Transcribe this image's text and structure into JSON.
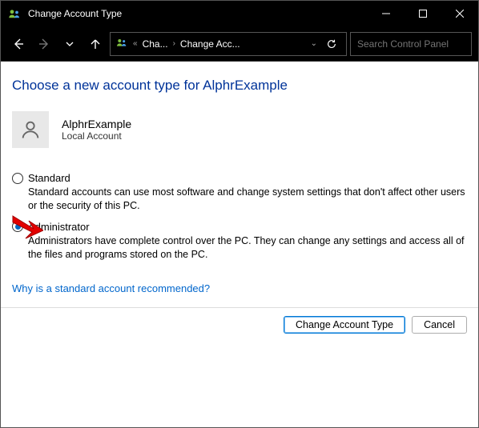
{
  "window": {
    "title": "Change Account Type",
    "search_placeholder": "Search Control Panel"
  },
  "breadcrumb": {
    "item1": "Cha...",
    "item2": "Change Acc..."
  },
  "page": {
    "heading": "Choose a new account type for AlphrExample",
    "account_name": "AlphrExample",
    "account_sub": "Local Account"
  },
  "options": {
    "standard": {
      "label": "Standard",
      "desc": "Standard accounts can use most software and change system settings that don't affect other users or the security of this PC."
    },
    "admin": {
      "label": "Administrator",
      "desc": "Administrators have complete control over the PC. They can change any settings and access all of the files and programs stored on the PC."
    }
  },
  "link_text": "Why is a standard account recommended?",
  "buttons": {
    "change": "Change Account Type",
    "cancel": "Cancel"
  }
}
